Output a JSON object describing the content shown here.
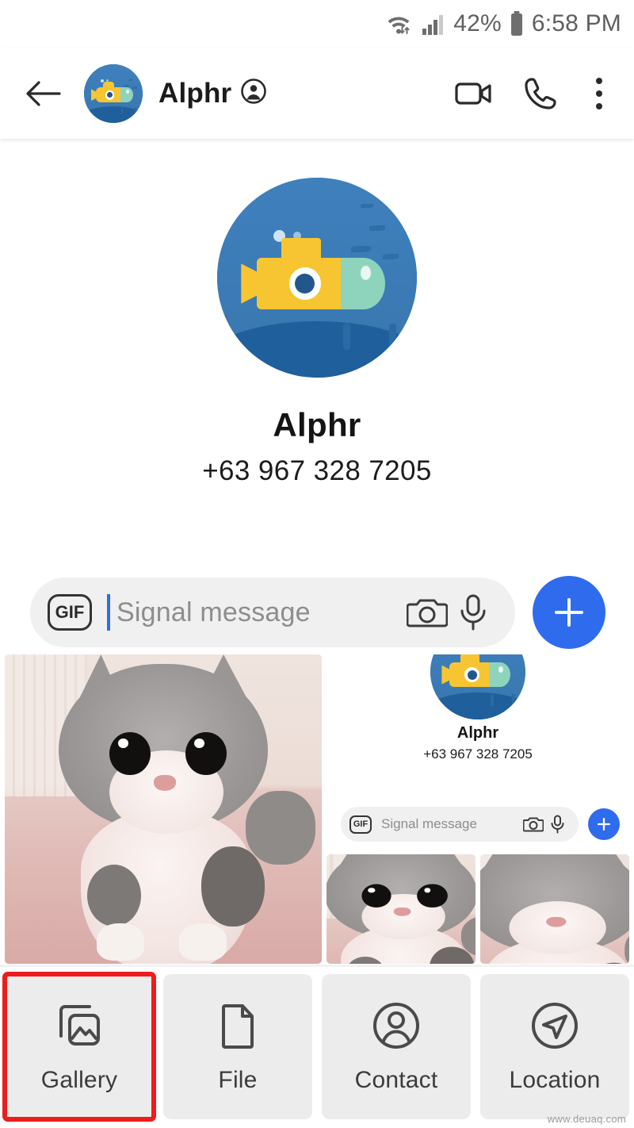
{
  "status_bar": {
    "wifi_icon": "wifi-with-transfer-arrows-icon",
    "signal_icon": "cellular-signal-icon",
    "battery_percent": "42%",
    "battery_icon": "battery-icon",
    "time": "6:58 PM"
  },
  "toolbar": {
    "back_icon": "back-arrow-icon",
    "avatar_name": "submarine-avatar",
    "title": "Alphr",
    "verified_icon": "contact-circle-icon",
    "video_call_icon": "video-camera-icon",
    "voice_call_icon": "phone-handset-icon",
    "overflow_icon": "three-dot-menu-icon"
  },
  "profile": {
    "name": "Alphr",
    "phone": "+63 967 328 7205",
    "avatar_name": "submarine-avatar-large"
  },
  "compose": {
    "gif_label": "GIF",
    "placeholder": "Signal message",
    "camera_icon": "camera-icon",
    "mic_icon": "microphone-icon",
    "plus_icon": "plus-icon"
  },
  "media_strip": {
    "items": [
      {
        "name": "kitten-photo-large",
        "type": "photo"
      },
      {
        "name": "signal-screenshot-thumbnail",
        "type": "screenshot"
      },
      {
        "name": "kitten-photo-small-1",
        "type": "photo"
      },
      {
        "name": "kitten-photo-small-2",
        "type": "photo"
      }
    ],
    "nested_screenshot": {
      "name": "Alphr",
      "phone": "+63 967 328 7205",
      "gif_label": "GIF",
      "placeholder": "Signal message"
    }
  },
  "attachments": {
    "tiles": [
      {
        "label": "Gallery",
        "icon": "gallery-icon",
        "selected": true
      },
      {
        "label": "File",
        "icon": "file-icon",
        "selected": false
      },
      {
        "label": "Contact",
        "icon": "contact-icon",
        "selected": false
      },
      {
        "label": "Location",
        "icon": "location-arrow-icon",
        "selected": false
      }
    ]
  },
  "watermark": "www.deuaq.com",
  "colors": {
    "accent_blue": "#2f6bed",
    "highlight_red": "#ee1c1c",
    "tile_gray": "#ececec",
    "field_gray": "#f0f0f0",
    "submarine_yellow": "#f7c531",
    "submarine_water": "#3a7cb8"
  }
}
